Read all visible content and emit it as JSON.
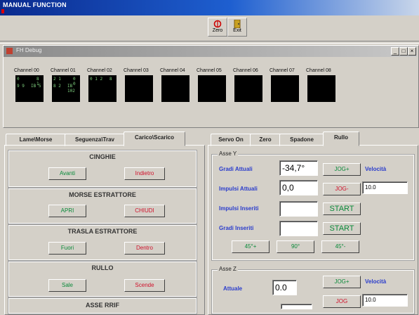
{
  "window": {
    "title": "MANUAL FUNCTION"
  },
  "toolbar": {
    "zero_label": "Zero",
    "exit_label": "Exit"
  },
  "debug": {
    "title": "FH Debug",
    "controls": {
      "minimize": "_",
      "restore": "□",
      "close": "×"
    },
    "channels": [
      {
        "label": "Channel 00",
        "lines": [
          "0",
          "8 1",
          "9 9",
          "IB 5"
        ]
      },
      {
        "label": "Channel 01",
        "lines": [
          "2 1",
          "0 0",
          "8 2",
          "IB 102"
        ]
      },
      {
        "label": "Channel 02",
        "lines": [
          "0 1 2",
          "8"
        ]
      },
      {
        "label": "Channel 03",
        "lines": []
      },
      {
        "label": "Channel 04",
        "lines": []
      },
      {
        "label": "Channel 05",
        "lines": []
      },
      {
        "label": "Channel 06",
        "lines": []
      },
      {
        "label": "Channel 07",
        "lines": []
      },
      {
        "label": "Channel 08",
        "lines": []
      }
    ]
  },
  "left_tabs": [
    "Lame\\Morse",
    "Seguenza\\Trav",
    "Carico\\Scarico"
  ],
  "left_groups": [
    {
      "title": "CINGHIE",
      "btn_green": "Avanti",
      "btn_red": "Indietro"
    },
    {
      "title": "MORSE ESTRATTORE",
      "btn_green": "APRI",
      "btn_red": "CHIUDI"
    },
    {
      "title": "TRASLA ESTRATTORE",
      "btn_green": "Fuori",
      "btn_red": "Dentro"
    },
    {
      "title": "RULLO",
      "btn_green": "Sale",
      "btn_red": "Scende"
    },
    {
      "title": "ASSE RRIF"
    }
  ],
  "right_tabs": [
    "Servo On",
    "Zero",
    "Spadone",
    "Rullo"
  ],
  "asse_y": {
    "title": "Asse Y",
    "gradi_attuali_label": "Gradi Attuali",
    "gradi_attuali_value": "-34,7°",
    "impulsi_attuali_label": "Impulsi Attuali",
    "impulsi_attuali_value": "0,0",
    "impulsi_inseriti_label": "Impulsi Inseriti",
    "gradi_inseriti_label": "Gradi Inseriti",
    "jog_plus": "JOG+",
    "jog_minus": "JOG-",
    "velocita_label": "Velocità",
    "velocita_value": "10.0",
    "start1": "START",
    "start2": "START",
    "preset_a": "45°+",
    "preset_b": "90°",
    "preset_c": "45°-"
  },
  "asse_z": {
    "title": "Asse Z",
    "attuale_label": "Attuale",
    "attuale_value": "0.0",
    "jog_plus": "JOG+",
    "jog_minus": "JOG",
    "velocita_label": "Velocità",
    "velocita_value": "10.0"
  }
}
